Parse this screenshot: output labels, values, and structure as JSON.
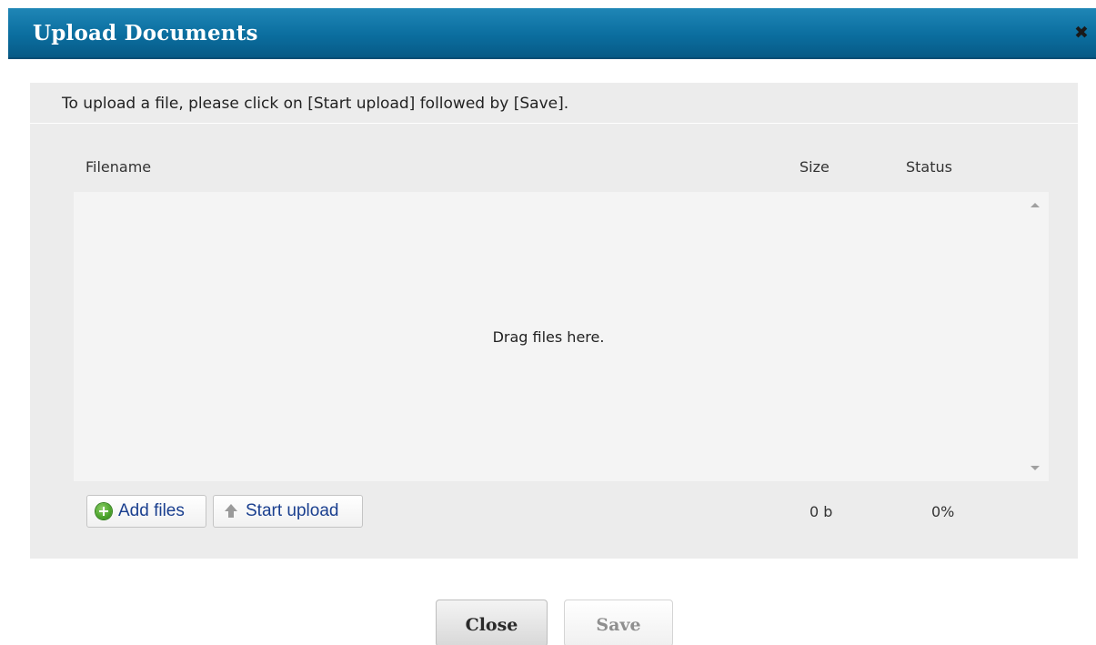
{
  "dialog": {
    "title": "Upload Documents",
    "close_icon": "close-icon"
  },
  "instructions": "To upload a file, please click on [Start upload] followed by [Save].",
  "table": {
    "columns": [
      "Filename",
      "Size",
      "Status"
    ],
    "empty_message": "Drag files here."
  },
  "toolbar": {
    "add_files_label": "Add files",
    "add_files_icon": "plus-circle-icon",
    "start_upload_label": "Start upload",
    "start_upload_icon": "arrow-up-icon",
    "total_size": "0 b",
    "total_percent": "0%"
  },
  "footer": {
    "close_label": "Close",
    "save_label": "Save"
  },
  "colors": {
    "titlebar": "#0b6e9f",
    "panel": "#ececec",
    "dropzone": "#f4f4f4",
    "link_text": "#1a3f8f"
  }
}
